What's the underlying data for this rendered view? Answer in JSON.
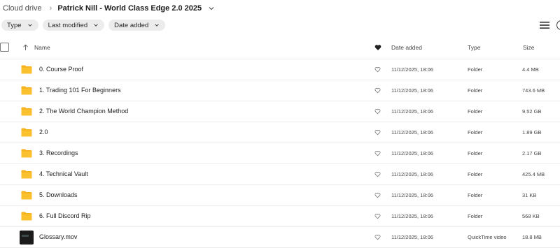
{
  "breadcrumb": {
    "root": "Cloud drive",
    "current": "Patrick Nill - World Class Edge 2.0 2025"
  },
  "filters": [
    {
      "label": "Type"
    },
    {
      "label": "Last modified"
    },
    {
      "label": "Date added"
    }
  ],
  "columns": {
    "name": "Name",
    "date_added": "Date added",
    "type": "Type",
    "size": "Size"
  },
  "colors": {
    "folder": "#f7b21b",
    "folder_tab": "#e9a10f"
  },
  "rows": [
    {
      "name": "0. Course Proof",
      "date": "11/12/2025, 18:06",
      "type": "Folder",
      "size": "4.4 MB",
      "icon": "folder-icon"
    },
    {
      "name": "1. Trading 101 For Beginners",
      "date": "11/12/2025, 18:06",
      "type": "Folder",
      "size": "743.6 MB",
      "icon": "folder-icon"
    },
    {
      "name": "2. The World Champion Method",
      "date": "11/12/2025, 18:06",
      "type": "Folder",
      "size": "9.52 GB",
      "icon": "folder-icon"
    },
    {
      "name": "2.0",
      "date": "11/12/2025, 18:06",
      "type": "Folder",
      "size": "1.89 GB",
      "icon": "folder-icon"
    },
    {
      "name": "3. Recordings",
      "date": "11/12/2025, 18:06",
      "type": "Folder",
      "size": "2.17 GB",
      "icon": "folder-icon"
    },
    {
      "name": "4. Technical Vault",
      "date": "11/12/2025, 18:06",
      "type": "Folder",
      "size": "425.4 MB",
      "icon": "folder-icon"
    },
    {
      "name": "5. Downloads",
      "date": "11/12/2025, 18:06",
      "type": "Folder",
      "size": "31 KB",
      "icon": "folder-icon"
    },
    {
      "name": "6. Full Discord Rip",
      "date": "11/12/2025, 18:06",
      "type": "Folder",
      "size": "568 KB",
      "icon": "folder-icon"
    },
    {
      "name": "Glossary.mov",
      "date": "11/12/2025, 18:06",
      "type": "QuickTime video",
      "size": "18.8 MB",
      "icon": "video-thumbnail"
    }
  ]
}
